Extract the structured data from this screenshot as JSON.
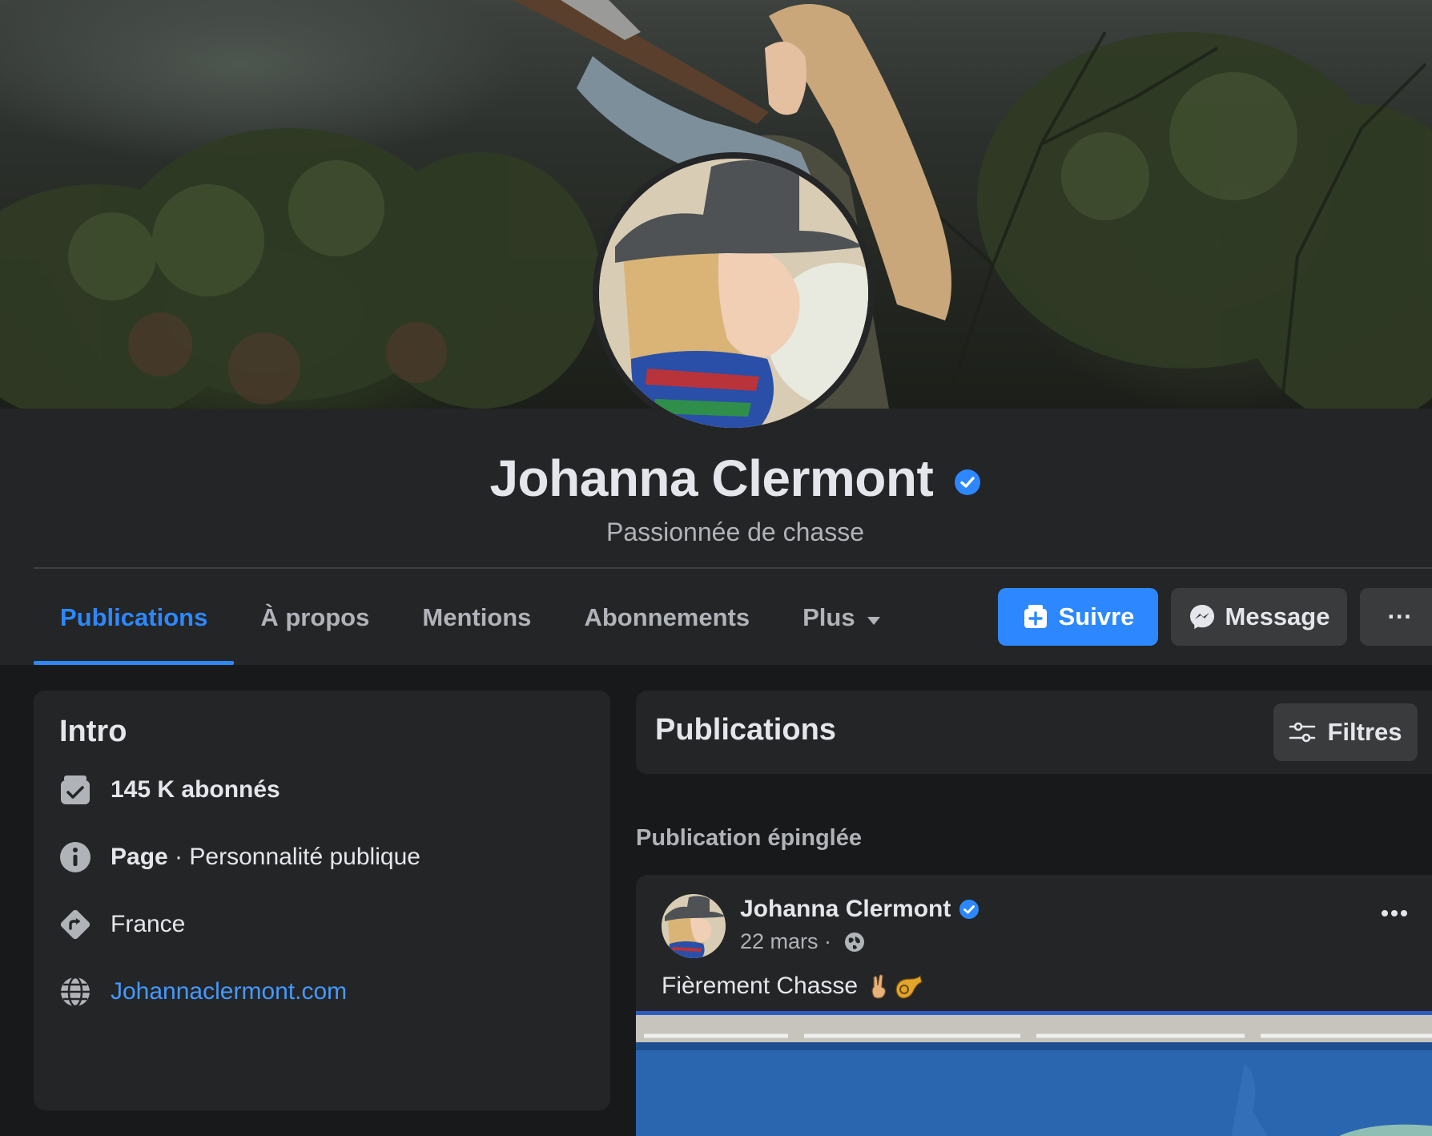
{
  "profile": {
    "name": "Johanna Clermont",
    "subtitle": "Passionnée de chasse"
  },
  "tabs": [
    {
      "label": "Publications",
      "active": true
    },
    {
      "label": "À propos",
      "active": false
    },
    {
      "label": "Mentions",
      "active": false
    },
    {
      "label": "Abonnements",
      "active": false
    },
    {
      "label": "Plus",
      "active": false
    }
  ],
  "actions": {
    "follow_label": "Suivre",
    "message_label": "Message",
    "more_label": "···"
  },
  "intro": {
    "title": "Intro",
    "followers": "145 K abonnés",
    "page_label": "Page",
    "page_separator": " · ",
    "page_category": "Personnalité publique",
    "location": "France",
    "website": "Johannaclermont.com"
  },
  "publications": {
    "title": "Publications",
    "filters_label": "Filtres",
    "pinned_label": "Publication épinglée"
  },
  "post": {
    "author": "Johanna Clermont",
    "date": "22 mars",
    "meta_separator": " · ",
    "text": "Fièrement Chasse",
    "emojis": "✌️📯"
  },
  "colors": {
    "accent": "#2d88ff",
    "background": "#18191a",
    "card": "#242526",
    "button": "#3a3b3c",
    "link": "#4599ff",
    "text_primary": "#e4e6eb",
    "text_secondary": "#b0b3b8"
  },
  "icons": {
    "verified": "verified-badge-icon",
    "follow": "follow-plus-icon",
    "message": "messenger-icon",
    "followers": "followers-check-icon",
    "info": "info-icon",
    "location": "location-direction-icon",
    "website": "globe-icon",
    "filters": "sliders-icon",
    "privacy": "globe-icon"
  }
}
